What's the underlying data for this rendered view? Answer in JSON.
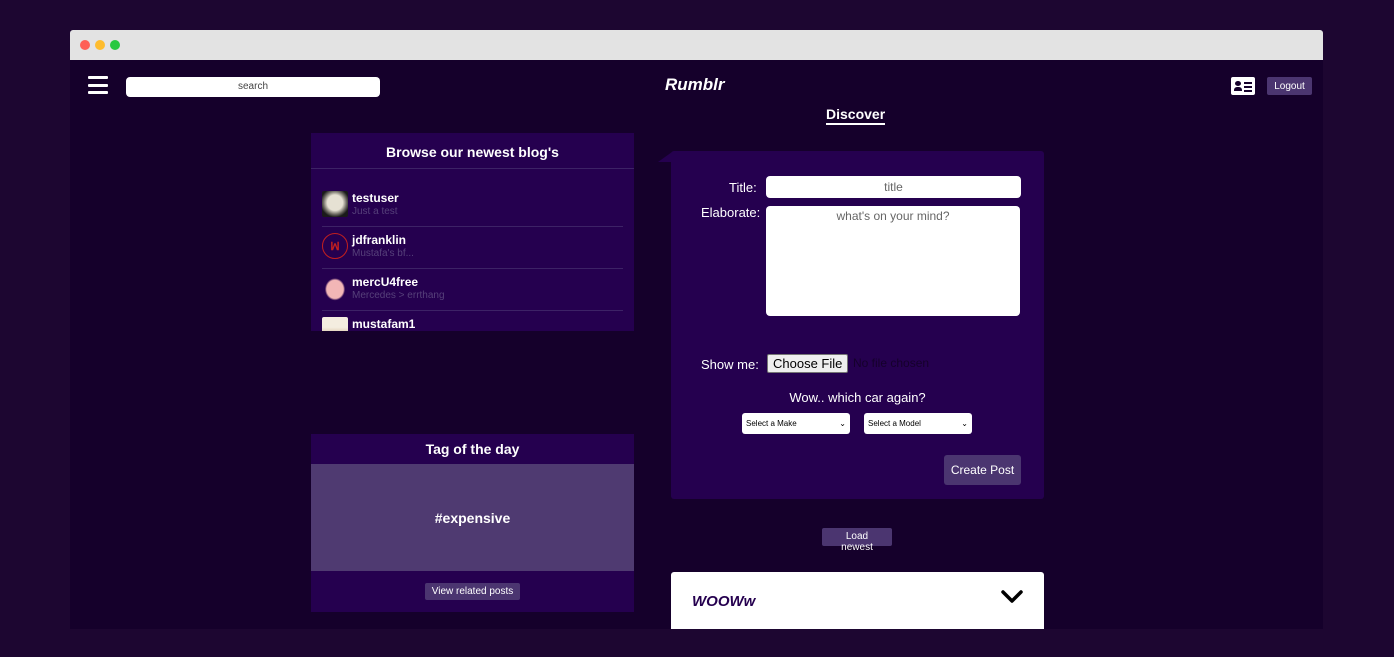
{
  "app": {
    "title": "Rumblr"
  },
  "header": {
    "search_placeholder": "search",
    "logout_label": "Logout",
    "menu_icon": "hamburger-menu-icon",
    "profile_icon": "profile-card-icon"
  },
  "main": {
    "section_title": "Discover"
  },
  "sidebar": {
    "blogs_title": "Browse our newest blog's",
    "blogs": [
      {
        "name": "testuser",
        "desc": "Just a test"
      },
      {
        "name": "jdfranklin",
        "desc": "Mustafa's bf..."
      },
      {
        "name": "mercU4free",
        "desc": "Mercedes > errthang"
      },
      {
        "name": "mustafam1",
        "desc": ""
      }
    ],
    "tag_title": "Tag of the day",
    "tag_value": "#expensive",
    "tag_button": "View related posts"
  },
  "form": {
    "title_label": "Title:",
    "title_placeholder": "title",
    "elaborate_label": "Elaborate:",
    "elaborate_placeholder": "what's on your mind?",
    "show_label": "Show me:",
    "file_button": "Choose File",
    "file_status": "No file chosen",
    "car_question": "Wow.. which car again?",
    "make_select": "Select a Make",
    "model_select": "Select a Model",
    "submit_label": "Create Post"
  },
  "feed": {
    "load_newest_label": "Load newest",
    "first_post_title": "WOOWw"
  },
  "colors": {
    "background": "#15002b",
    "panel": "#25004f",
    "accent": "#4b3570",
    "tag_body": "#4f3a71"
  }
}
